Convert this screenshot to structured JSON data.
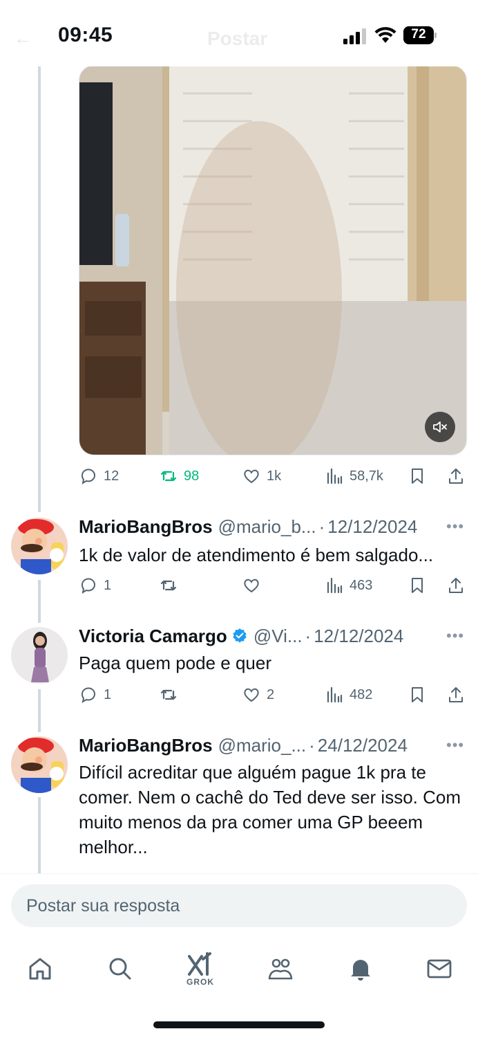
{
  "status_bar": {
    "time": "09:45",
    "battery": "72",
    "battery_level": 0.72,
    "ghost_title": "Postar"
  },
  "post": {
    "media_alt_icon": "video-thumbnail",
    "actions": {
      "replies": "12",
      "reposts": "98",
      "likes": "1k",
      "views": "58,7k"
    },
    "colors": {
      "repost_active": "#00ba7c"
    }
  },
  "replies": [
    {
      "name": "MarioBangBros",
      "handle": "@mario_b...",
      "date": "12/12/2024",
      "text": "1k de valor de atendimento é bem salgado...",
      "counts": {
        "replies": "1",
        "reposts": "",
        "likes": "",
        "views": "463"
      }
    },
    {
      "name": "Victoria Camargo",
      "verified": true,
      "handle": "@Vi...",
      "date": "12/12/2024",
      "text": "Paga quem pode e quer",
      "counts": {
        "replies": "1",
        "reposts": "",
        "likes": "2",
        "views": "482"
      }
    },
    {
      "name": "MarioBangBros",
      "handle": "@mario_...",
      "date": "24/12/2024",
      "text": "Difícil acreditar que alguém pague 1k pra te comer. Nem o cachê do Ted deve ser isso. Com muito menos da pra comer uma GP beeem melhor..."
    }
  ],
  "composer": {
    "placeholder": "Postar sua resposta"
  },
  "nav": {
    "items": [
      "home-icon",
      "search-icon",
      "grok-icon",
      "communities-icon",
      "notifications-icon",
      "messages-icon"
    ],
    "grok_label": "GROK"
  }
}
